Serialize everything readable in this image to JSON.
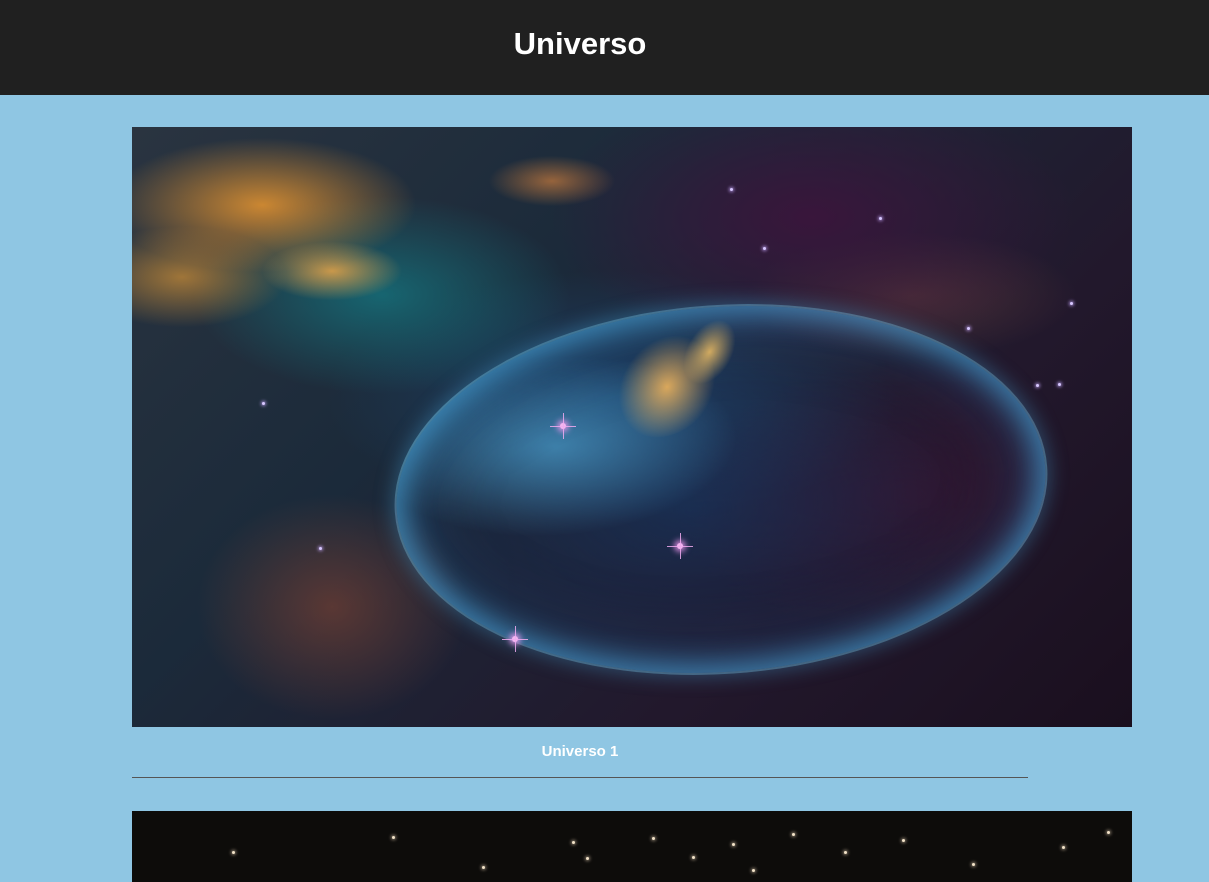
{
  "header": {
    "title": "Universo"
  },
  "gallery": [
    {
      "caption": "Universo 1"
    }
  ],
  "colors": {
    "header_bg": "#202020",
    "page_bg": "#8fc6e3",
    "text": "#ffffff",
    "divider": "#555555"
  }
}
